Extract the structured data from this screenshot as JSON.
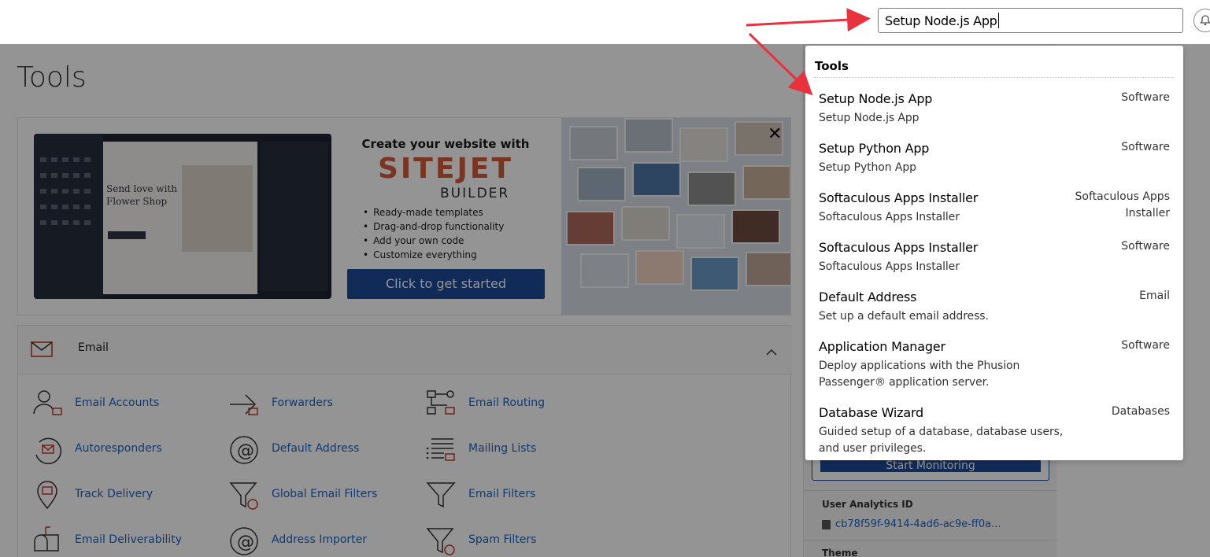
{
  "search": {
    "value": "Setup Node.js App"
  },
  "page": {
    "title": "Tools"
  },
  "banner": {
    "heading": "Create your website with",
    "logo": "SITEJET",
    "logo_sub": "BUILDER",
    "features": [
      "Ready-made templates",
      "Drag-and-drop functionality",
      "Add your own code",
      "Customize everything"
    ],
    "cta_label": "Click to get started",
    "preview_title": "Send love with Flower Shop",
    "close_glyph": "✕"
  },
  "email_section": {
    "title": "Email",
    "tools": [
      {
        "label": "Email Accounts",
        "icon": "email-accounts-icon"
      },
      {
        "label": "Forwarders",
        "icon": "forwarders-icon"
      },
      {
        "label": "Email Routing",
        "icon": "email-routing-icon"
      },
      {
        "label": "Autoresponders",
        "icon": "autoresponders-icon"
      },
      {
        "label": "Default Address",
        "icon": "at-sign-icon"
      },
      {
        "label": "Mailing Lists",
        "icon": "mailing-lists-icon"
      },
      {
        "label": "Track Delivery",
        "icon": "track-delivery-icon"
      },
      {
        "label": "Global Email Filters",
        "icon": "global-filter-icon"
      },
      {
        "label": "Email Filters",
        "icon": "filter-icon"
      },
      {
        "label": "Email Deliverability",
        "icon": "mailbox-icon"
      },
      {
        "label": "Address Importer",
        "icon": "address-importer-icon"
      },
      {
        "label": "Spam Filters",
        "icon": "spam-filter-icon"
      }
    ]
  },
  "side": {
    "monitor_button": "Start Monitoring",
    "analytics_label": "User Analytics ID",
    "analytics_value": "cb78f59f-9414-4ad6-ac9e-ff0a...",
    "theme_label": "Theme"
  },
  "dropdown": {
    "header": "Tools",
    "items": [
      {
        "name": "Setup Node.js App",
        "desc": "Setup Node.js App",
        "category": "Software"
      },
      {
        "name": "Setup Python App",
        "desc": "Setup Python App",
        "category": "Software"
      },
      {
        "name": "Softaculous Apps Installer",
        "desc": "Softaculous Apps Installer",
        "category": "Softaculous Apps Installer"
      },
      {
        "name": "Softaculous Apps Installer",
        "desc": "Softaculous Apps Installer",
        "category": "Software"
      },
      {
        "name": "Default Address",
        "desc": "Set up a default email address.",
        "category": "Email"
      },
      {
        "name": "Application Manager",
        "desc": "Deploy applications with the Phusion Passenger® application server.",
        "category": "Software"
      },
      {
        "name": "Database Wizard",
        "desc": "Guided setup of a database, database users, and user privileges.",
        "category": "Databases"
      }
    ]
  },
  "colors": {
    "accent": "#1e4a99",
    "link": "#1a63c4",
    "annotation_arrow": "#e8333f",
    "sitejet_orange": "#d25a3c"
  }
}
